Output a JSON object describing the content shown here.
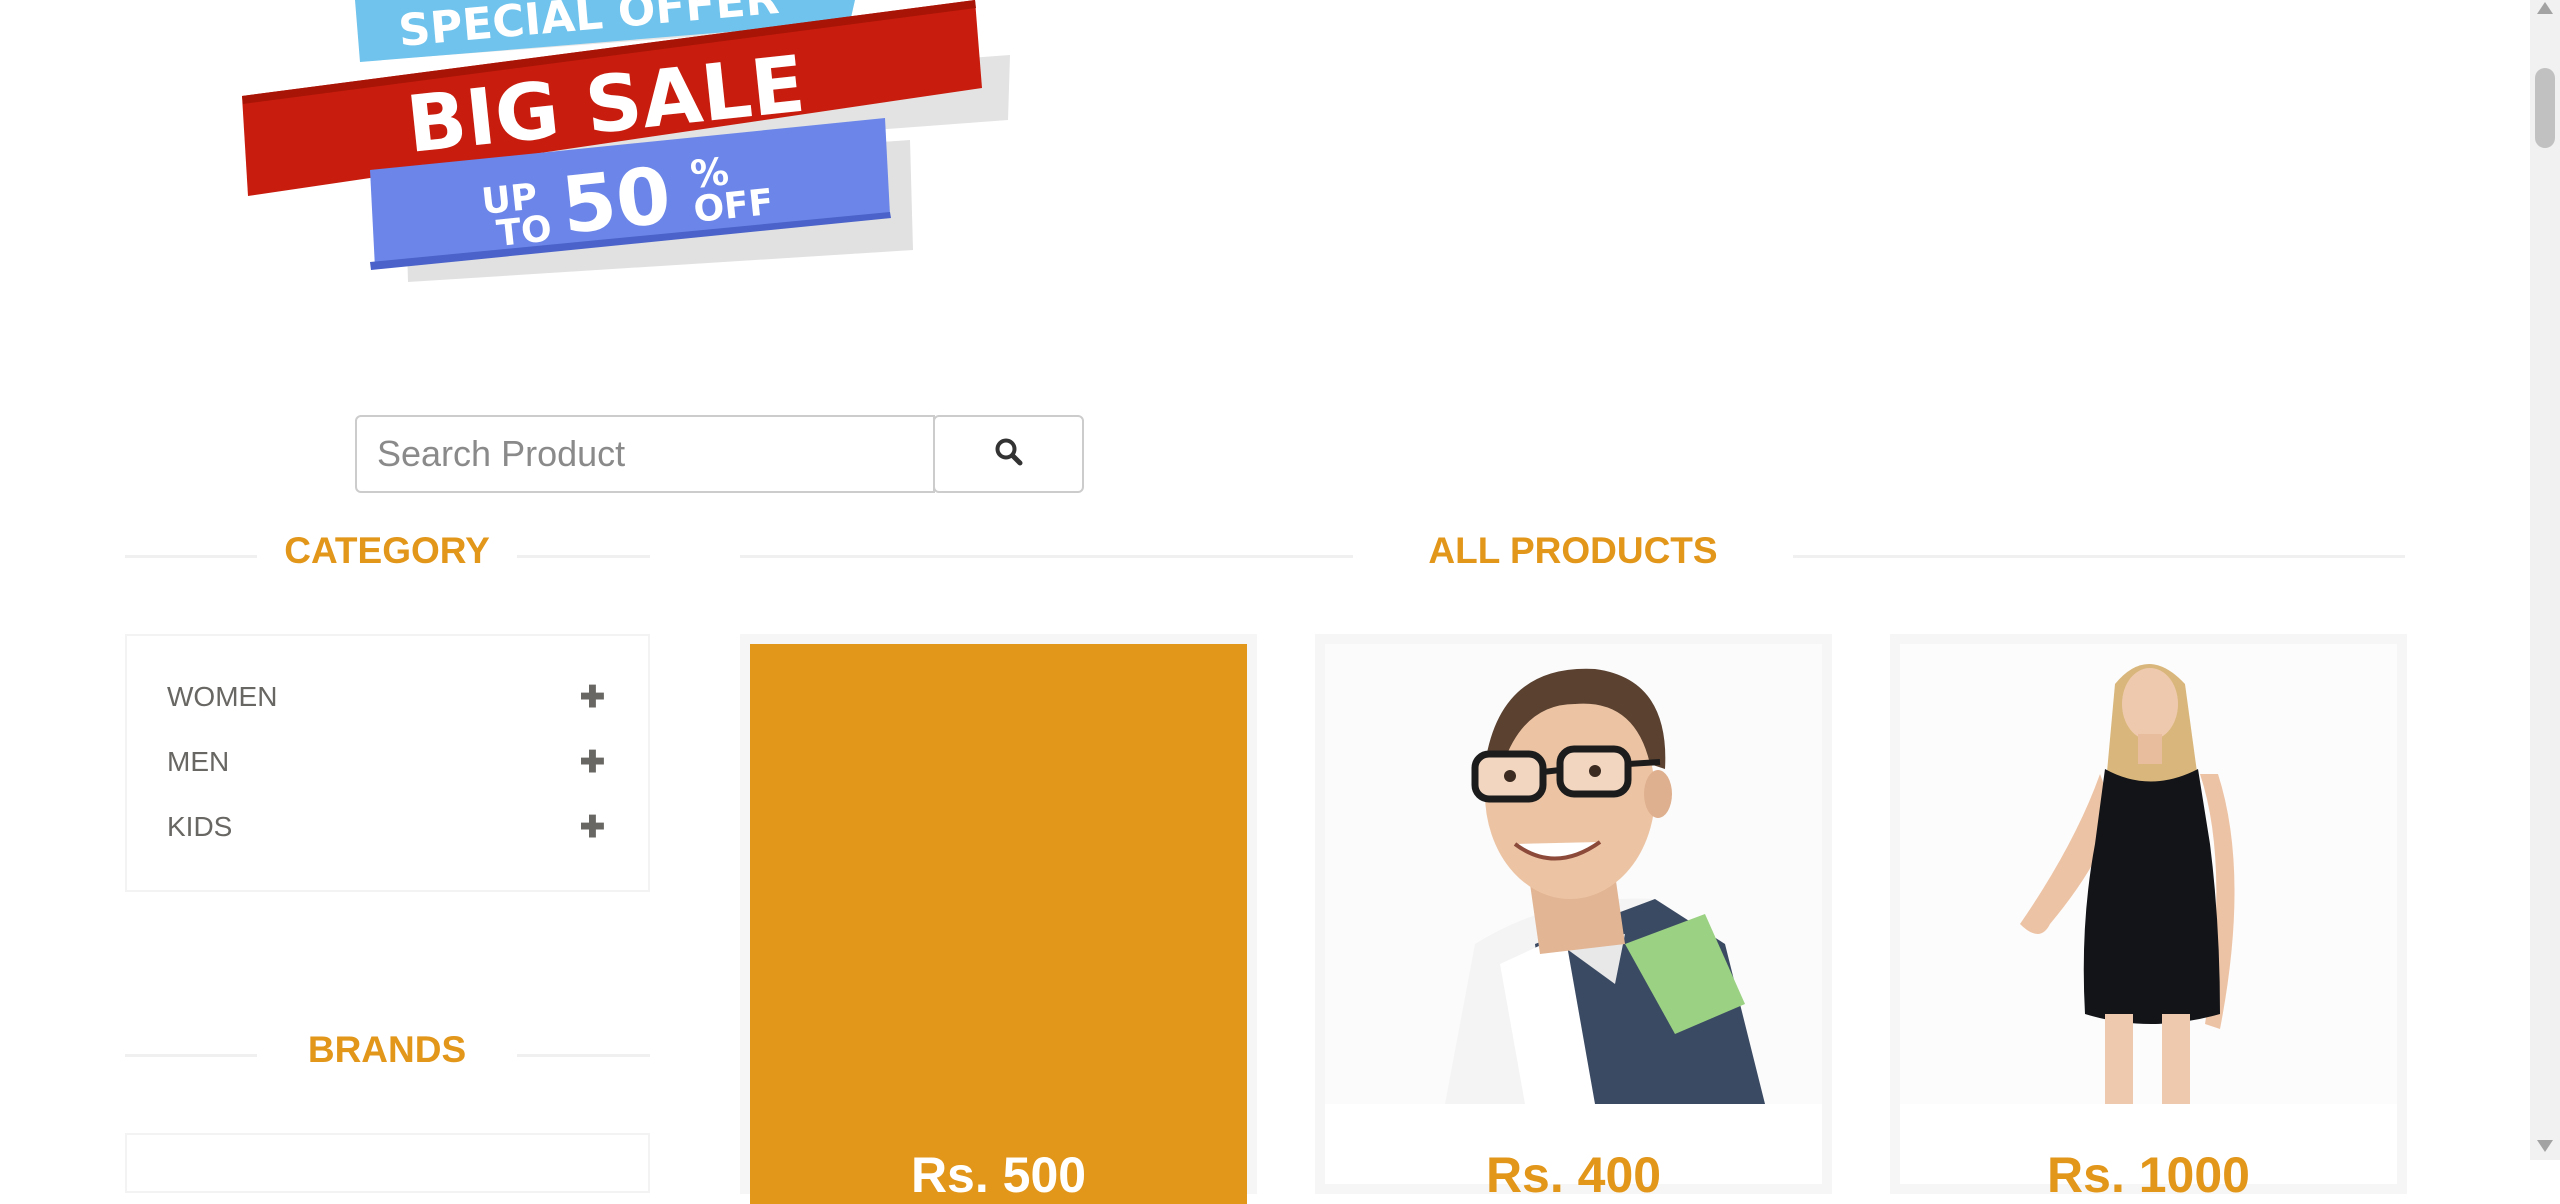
{
  "banner": {
    "line1": "SPECIAL OFFER",
    "line2": "BIG SALE",
    "line3_up": "UP",
    "line3_to": "TO",
    "line3_value": "50",
    "line3_percent": "%",
    "line3_off": "OFF"
  },
  "search": {
    "placeholder": "Search Product",
    "icon": "search-icon"
  },
  "sidebar": {
    "category_title": "CATEGORY",
    "categories": [
      {
        "label": "WOMEN",
        "icon": "plus-icon"
      },
      {
        "label": "MEN",
        "icon": "plus-icon"
      },
      {
        "label": "KIDS",
        "icon": "plus-icon"
      }
    ],
    "brands_title": "BRANDS"
  },
  "main": {
    "title": "ALL PRODUCTS",
    "products": [
      {
        "price": "Rs. 500"
      },
      {
        "price": "Rs. 400"
      },
      {
        "price": "Rs. 1000"
      }
    ]
  },
  "colors": {
    "accent": "#e2961a",
    "text": "#696763",
    "banner_red": "#c81d0e",
    "banner_light_blue": "#6fc3ec",
    "banner_blue": "#6b86e8"
  }
}
